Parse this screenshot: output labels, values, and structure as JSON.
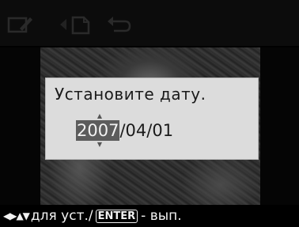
{
  "toolbar": {
    "icons": [
      "pen-edit-icon",
      "document-icon",
      "undo-icon"
    ]
  },
  "dialog": {
    "title": "Установите дату.",
    "year": "2007",
    "separator1": " / ",
    "month": "04",
    "separator2": " / ",
    "day": "01"
  },
  "statusbar": {
    "arrows": "◀▶▲▼",
    "adjust_text": "для уст./",
    "enter_label": "ENTER",
    "confirm_text": "- вып."
  },
  "colors": {
    "dialog_bg": "#dcdcdc",
    "highlight": "#5c5c5c",
    "statusbar_bg": "#000000"
  }
}
